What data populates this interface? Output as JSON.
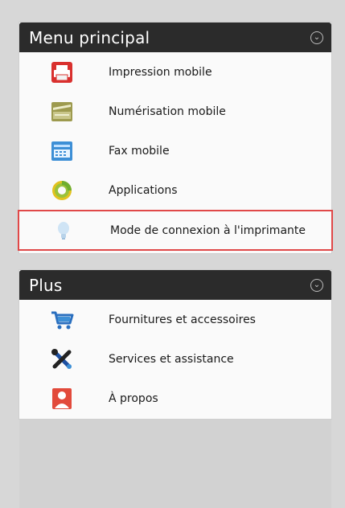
{
  "main_menu": {
    "title": "Menu principal",
    "items": [
      {
        "label": "Impression mobile",
        "icon": "printer-icon"
      },
      {
        "label": "Numérisation mobile",
        "icon": "scanner-icon"
      },
      {
        "label": "Fax mobile",
        "icon": "fax-icon"
      },
      {
        "label": "Applications",
        "icon": "apps-icon"
      },
      {
        "label": "Mode de connexion à l'imprimante",
        "icon": "lightbulb-icon",
        "selected": true
      }
    ]
  },
  "plus_menu": {
    "title": "Plus",
    "items": [
      {
        "label": "Fournitures et accessoires",
        "icon": "cart-icon"
      },
      {
        "label": "Services et assistance",
        "icon": "tools-icon"
      },
      {
        "label": "À propos",
        "icon": "person-icon"
      }
    ]
  },
  "colors": {
    "header_bg": "#2b2b2b",
    "selection_border": "#e04848",
    "background": "#d7d7d7"
  }
}
